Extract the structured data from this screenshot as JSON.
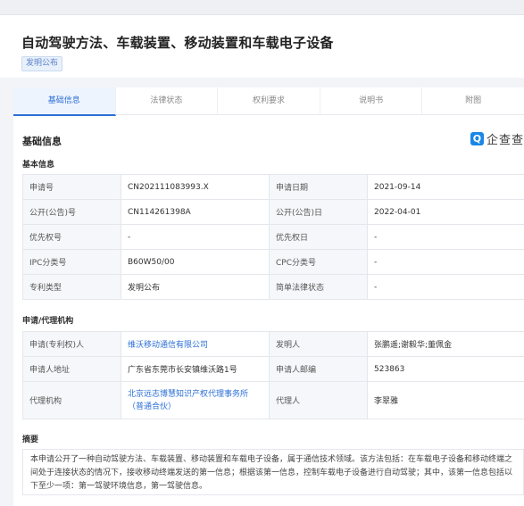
{
  "patent": {
    "title": "自动驾驶方法、车载装置、移动装置和车载电子设备",
    "type_badge": "发明公布"
  },
  "tabs": [
    "基础信息",
    "法律状态",
    "权利要求",
    "说明书",
    "附图"
  ],
  "active_tab": "基础信息",
  "section_title": "基础信息",
  "brand": {
    "logo_glyph": "Q",
    "text": "企查查"
  },
  "basic": {
    "heading": "基本信息",
    "rows": [
      [
        "申请号",
        "CN202111083993.X",
        "申请日期",
        "2021-09-14"
      ],
      [
        "公开(公告)号",
        "CN114261398A",
        "公开(公告)日",
        "2022-04-01"
      ],
      [
        "优先权号",
        "-",
        "优先权日",
        "-"
      ],
      [
        "IPC分类号",
        "B60W50/00",
        "CPC分类号",
        "-"
      ],
      [
        "专利类型",
        "发明公布",
        "简单法律状态",
        "-"
      ]
    ]
  },
  "agency": {
    "heading": "申请/代理机构",
    "rows": [
      [
        "申请(专利权)人",
        "维沃移动通信有限公司",
        "发明人",
        "张鹏遥;谢毅华;董佩金"
      ],
      [
        "申请人地址",
        "广东省东莞市长安镇维沃路1号",
        "申请人邮编",
        "523863"
      ],
      [
        "代理机构",
        "北京远志博慧知识产权代理事务所（普通合伙）",
        "代理人",
        "李翠雅"
      ]
    ]
  },
  "abstract": {
    "heading": "摘要",
    "text": "本申请公开了一种自动驾驶方法、车载装置、移动装置和车载电子设备，属于通信技术领域。该方法包括：在车载电子设备和移动终端之间处于连接状态的情况下，接收移动终端发送的第一信息；根据该第一信息，控制车载电子设备进行自动驾驶；其中，该第一信息包括以下至少一项：第一驾驶环境信息，第一驾驶信息。"
  },
  "colors": {
    "accent": "#2b6fd6",
    "brand": "#1a86e8",
    "label_bg": "#f5f7fa"
  }
}
